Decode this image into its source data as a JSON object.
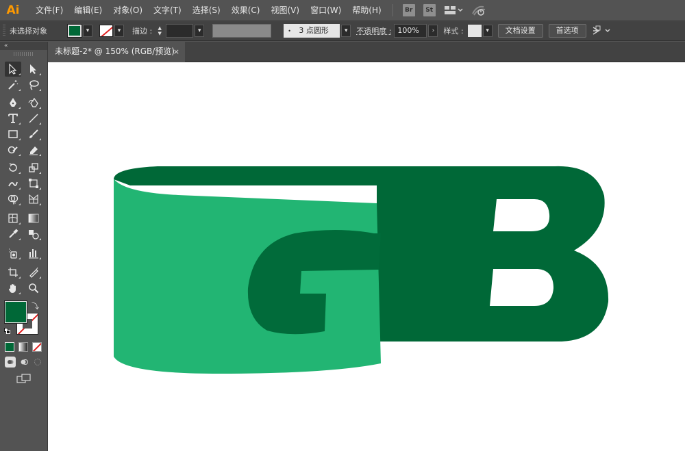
{
  "app": {
    "logo": "Ai"
  },
  "menu": {
    "items": [
      "文件(F)",
      "编辑(E)",
      "对象(O)",
      "文字(T)",
      "选择(S)",
      "效果(C)",
      "视图(V)",
      "窗口(W)",
      "帮助(H)"
    ],
    "badges": [
      "Br",
      "St"
    ]
  },
  "control": {
    "selection_label": "未选择对象",
    "stroke_label": "描边 :",
    "brush_value": "3 点圆形",
    "opacity_label": "不透明度 :",
    "opacity_value": "100%",
    "style_label": "样式 :",
    "doc_setup_button": "文档设置",
    "preferences_button": "首选项",
    "fill_color": "#006837",
    "stroke_color": "none"
  },
  "tab": {
    "title": "未标题-2* @ 150% (RGB/预览)",
    "close": "×"
  },
  "tools_panel": {
    "collapse": "«"
  },
  "artwork": {
    "letters": [
      "G",
      "B"
    ],
    "band_color": "#22b573",
    "dark_color": "#006837",
    "shadow_color": "#016b3a"
  }
}
